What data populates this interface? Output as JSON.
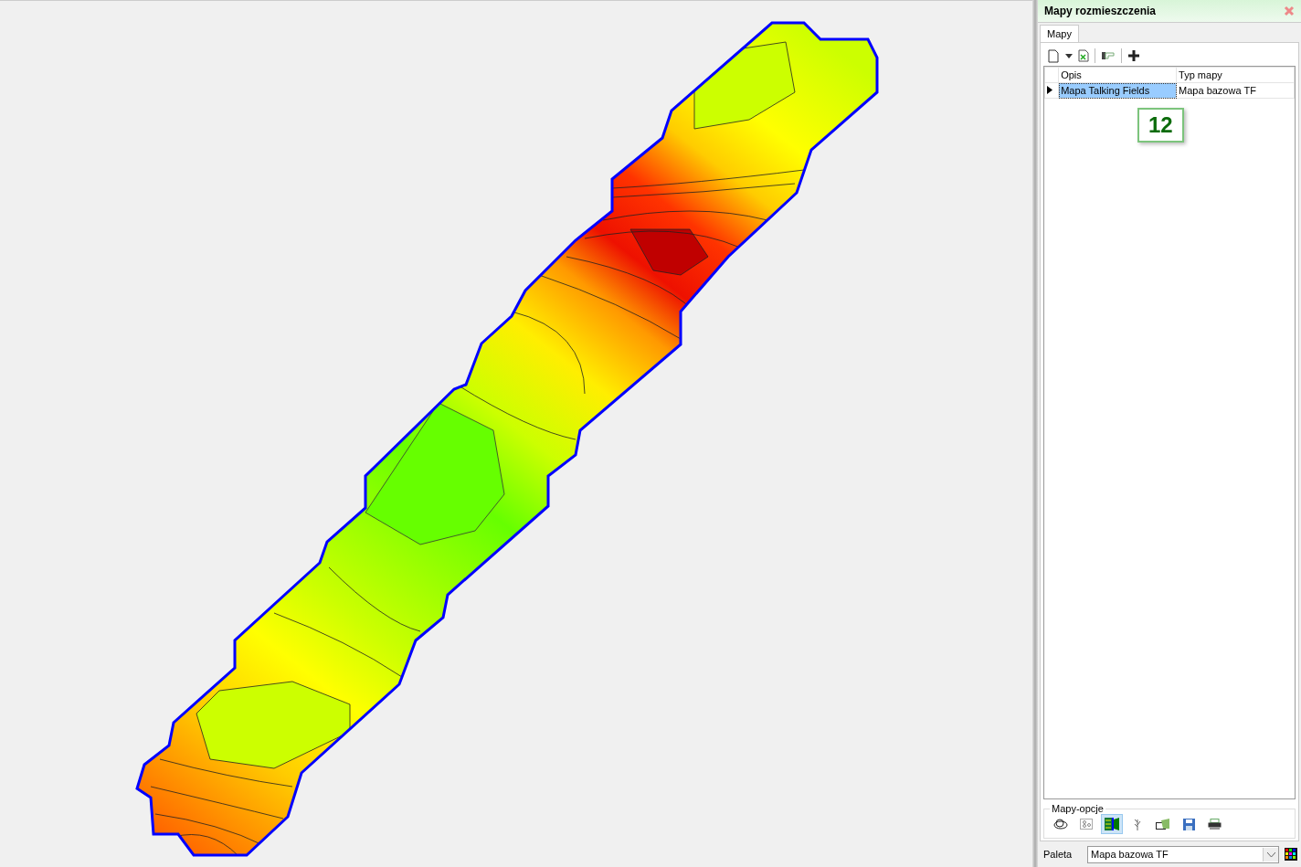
{
  "window": {
    "title": "Mapy rozmieszczenia"
  },
  "tabs": [
    {
      "label": "Mapy",
      "selected": true
    }
  ],
  "table": {
    "columns": [
      "Opis",
      "Typ mapy"
    ],
    "rows": [
      {
        "cells": [
          "Mapa Talking Fields",
          "Mapa bazowa TF"
        ],
        "selected": true
      }
    ]
  },
  "badge": "12",
  "options": {
    "title": "Mapy-opcje",
    "tools": [
      {
        "kind": "layers",
        "selected": false
      },
      {
        "kind": "points",
        "selected": false
      },
      {
        "kind": "map",
        "selected": true
      },
      {
        "kind": "plant",
        "selected": false
      },
      {
        "kind": "folder",
        "selected": false
      },
      {
        "kind": "save",
        "selected": false
      },
      {
        "kind": "print",
        "selected": false
      }
    ]
  },
  "palette": {
    "label": "Paleta",
    "value": "Mapa bazowa TF"
  }
}
